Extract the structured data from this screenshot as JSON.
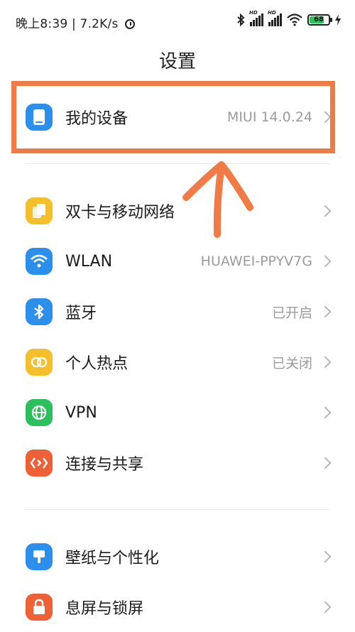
{
  "status": {
    "time_text": "晚上8:39",
    "speed_text": "7.2K/s",
    "battery_level": "68",
    "hd_label": "HD"
  },
  "title": "设置",
  "rows": [
    {
      "label": "我的设备",
      "value": "MIUI 14.0.24",
      "icon": "device-icon",
      "color": "#2c8fec"
    },
    {
      "label": "双卡与移动网络",
      "value": "",
      "icon": "sim-icon",
      "color": "#f3bf2a"
    },
    {
      "label": "WLAN",
      "value": "HUAWEI-PPYV7G",
      "icon": "wifi-icon",
      "color": "#2c8fec"
    },
    {
      "label": "蓝牙",
      "value": "已开启",
      "icon": "bluetooth-icon",
      "color": "#2c8fec"
    },
    {
      "label": "个人热点",
      "value": "已关闭",
      "icon": "hotspot-icon",
      "color": "#f3bf2a"
    },
    {
      "label": "VPN",
      "value": "",
      "icon": "globe-icon",
      "color": "#2cbf5e"
    },
    {
      "label": "连接与共享",
      "value": "",
      "icon": "share-icon",
      "color": "#ee6137"
    },
    {
      "label": "壁纸与个性化",
      "value": "",
      "icon": "brush-icon",
      "color": "#2c8fec"
    },
    {
      "label": "息屏与锁屏",
      "value": "",
      "icon": "lock-icon",
      "color": "#ee6137"
    }
  ],
  "colors": {
    "annotation": "#f07b46"
  }
}
